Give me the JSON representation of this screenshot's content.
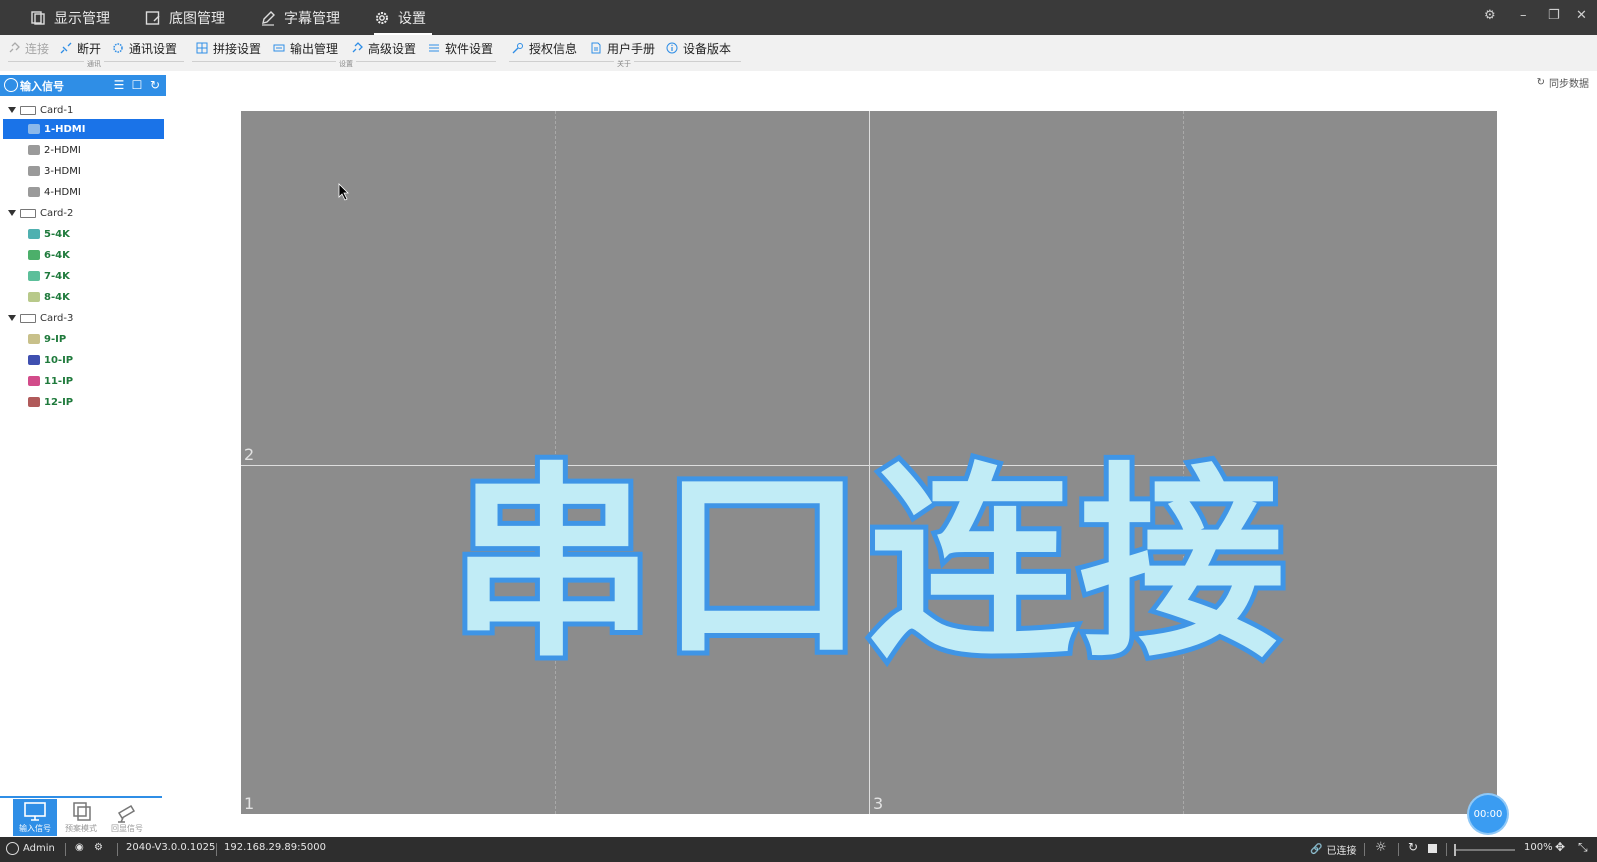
{
  "title_tabs": [
    {
      "label": "显示管理",
      "icon": "layers-icon"
    },
    {
      "label": "底图管理",
      "icon": "image-edit-icon"
    },
    {
      "label": "字幕管理",
      "icon": "pen-icon"
    },
    {
      "label": "设置",
      "icon": "gear-icon",
      "active": true
    }
  ],
  "toolbar": {
    "connect": "连接",
    "disconnect": "断开",
    "comm_settings": "通讯设置",
    "splice_settings": "拼接设置",
    "output_mgmt": "输出管理",
    "advanced_settings": "高级设置",
    "software_settings": "软件设置",
    "license_info": "授权信息",
    "user_manual": "用户手册",
    "device_version": "设备版本",
    "group_comm": "通讯",
    "group_settings": "设置",
    "group_about": "关于"
  },
  "left_panel": {
    "title": "输入信号",
    "cards": [
      {
        "name": "Card-1",
        "items": [
          {
            "label": "1-HDMI",
            "icon": "hdmi-icon",
            "selected": true
          },
          {
            "label": "2-HDMI",
            "icon": "hdmi-icon"
          },
          {
            "label": "3-HDMI",
            "icon": "hdmi-icon"
          },
          {
            "label": "4-HDMI",
            "icon": "hdmi-icon"
          }
        ]
      },
      {
        "name": "Card-2",
        "items": [
          {
            "label": "5-4K",
            "icon": "monitor-4k-icon"
          },
          {
            "label": "6-4K",
            "icon": "monitor-4k-icon"
          },
          {
            "label": "7-4K",
            "icon": "monitor-4k-icon"
          },
          {
            "label": "8-4K",
            "icon": "monitor-4k-icon"
          }
        ]
      },
      {
        "name": "Card-3",
        "items": [
          {
            "label": "9-IP",
            "icon": "ip-camera-icon"
          },
          {
            "label": "10-IP",
            "icon": "ip-camera-icon"
          },
          {
            "label": "11-IP",
            "icon": "ip-camera-icon"
          },
          {
            "label": "12-IP",
            "icon": "ip-camera-icon"
          }
        ]
      }
    ],
    "bottom_tabs": [
      {
        "label": "输入信号",
        "icon": "monitor-icon",
        "active": true
      },
      {
        "label": "预案模式",
        "icon": "copy-icon"
      },
      {
        "label": "回显信号",
        "icon": "camera-icon"
      }
    ]
  },
  "workspace": {
    "sync_label": "同步数据",
    "window_numbers": [
      "2",
      "1",
      "3"
    ],
    "overlay_text": "串口连接",
    "timer": "00:00"
  },
  "status_bar": {
    "user": "Admin",
    "version": "2040-V3.0.0.1025",
    "ip": "192.168.29.89:5000",
    "connection": "已连接",
    "zoom": "100%"
  },
  "colors": {
    "titlebar_bg": "#3a3a3a",
    "accent": "#2f8ee6",
    "selection": "#1a73e8",
    "canvas_bg": "#8c8c8c",
    "overlay_fill": "#c1ecf6",
    "overlay_stroke": "#3f95e6",
    "status_bg": "#2e2e2e"
  }
}
